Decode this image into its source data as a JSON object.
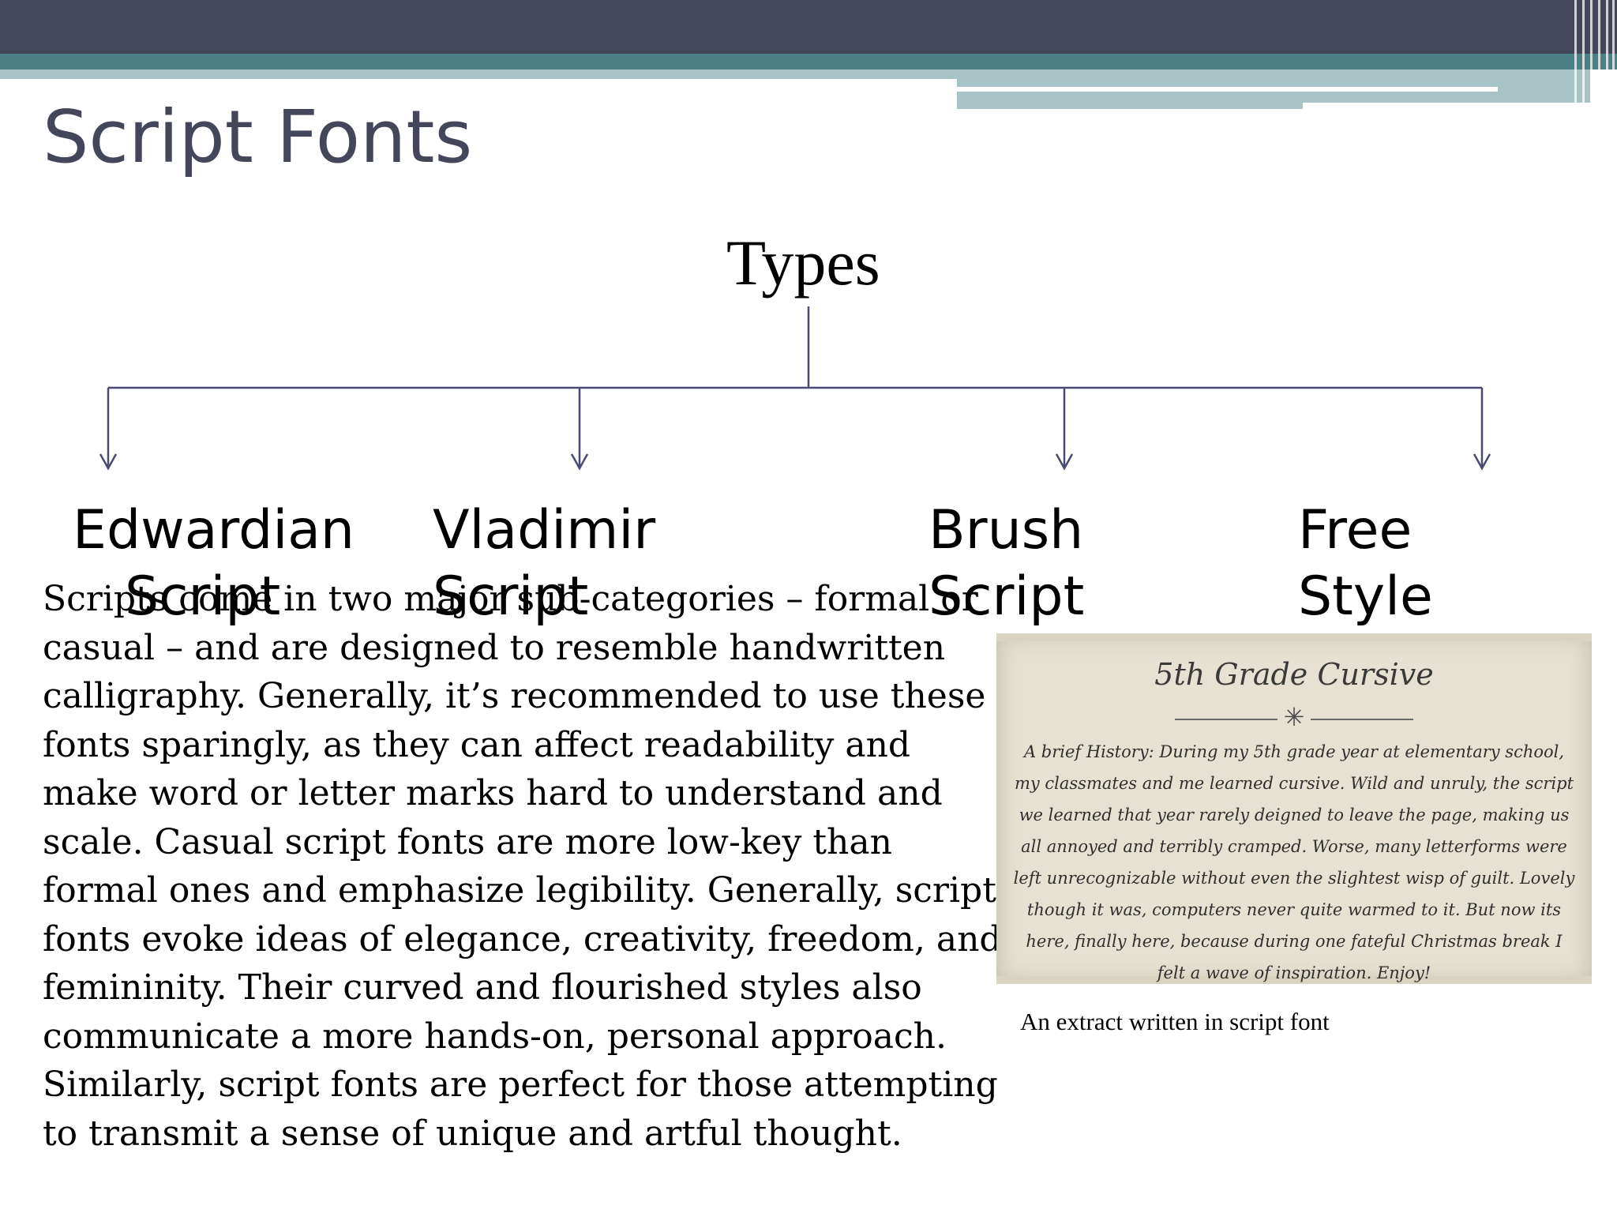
{
  "slide": {
    "title": "Script Fonts"
  },
  "diagram": {
    "root": "Types",
    "types": [
      {
        "line1": "Edwardian",
        "line2": "Script"
      },
      {
        "line1": "Vladimir",
        "line2": "Script"
      },
      {
        "line1": "Brush",
        "line2": "Script"
      },
      {
        "line1": "Free",
        "line2": "Style"
      }
    ]
  },
  "body": {
    "paragraph": "Scripts come in two major sub-categories – formal or casual – and are designed to resemble handwritten calligraphy. Generally, it’s recommended to use these fonts sparingly, as they can affect readability and make word or letter marks hard to understand and scale. Casual script fonts are more low-key than formal ones and emphasize legibility. Generally, script fonts evoke ideas of elegance, creativity, freedom, and femininity. Their curved and flourished styles also communicate a more hands-on, personal approach. Similarly, script fonts are perfect for those attempting to transmit a sense of unique and artful thought."
  },
  "figure": {
    "image_title": "5th Grade Cursive",
    "image_text": "A brief History: During my 5th grade year at elementary school, my classmates and me learned cursive. Wild and unruly, the script we learned that year rarely deigned to leave the page, making us all annoyed and terribly cramped. Worse, many letterforms were left unrecognizable without even the slightest wisp of guilt. Lovely though it was, computers never quite warmed to it. But now its here, finally here, because during one fateful Christmas break I felt a wave of inspiration. Enjoy!",
    "caption": "An extract written in script font"
  },
  "colors": {
    "header_dark": "#444659",
    "header_teal": "#4b8087",
    "header_light": "#a8c3c6",
    "title_text": "#444659",
    "connector": "#4a4a72",
    "paper": "#e6e1d2"
  }
}
